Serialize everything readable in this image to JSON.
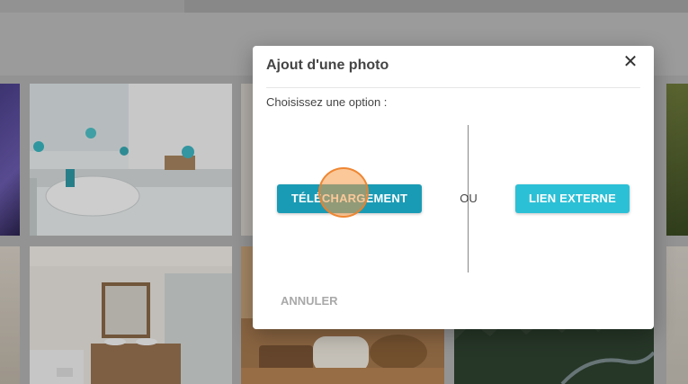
{
  "dialog": {
    "title": "Ajout d'une photo",
    "close_glyph": "✕",
    "prompt": "Choisissez une option :",
    "upload_button": "TÉLÉCHARGEMENT",
    "separator": "OU",
    "external_link_button": "LIEN EXTERNE",
    "cancel_button": "ANNULER"
  },
  "colors": {
    "upload_button": "#1a9bb5",
    "external_link_button": "#2cc0d6",
    "click_marker": "#f69b46"
  },
  "icons": [
    "close-icon"
  ],
  "gallery": {
    "photos": [
      "purple-photo",
      "bathroom-sink-photo",
      "bathroom-vanity-photo",
      "spa-products-photo",
      "forest-photo",
      "plant-photo"
    ]
  }
}
